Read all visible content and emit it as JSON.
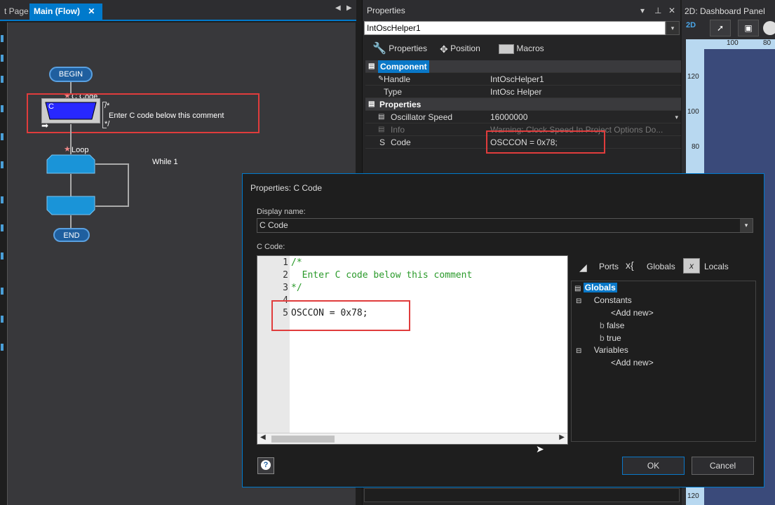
{
  "tabs": {
    "start_page": "t Page",
    "main_flow": "Main (Flow)",
    "close": "✕"
  },
  "flowchart": {
    "begin": "BEGIN",
    "ccode_label": "C Code",
    "ccode_letter": "C",
    "comment_open": "/*",
    "comment_text": "Enter C code below this comment",
    "comment_close": "*/",
    "loop_label": "Loop",
    "while_label": "While 1",
    "end": "END"
  },
  "properties_panel": {
    "title": "Properties",
    "selected_component": "IntOscHelper1",
    "toolbar": {
      "properties": "Properties",
      "position": "Position",
      "macros": "Macros"
    },
    "sections": {
      "component": "Component",
      "properties": "Properties"
    },
    "rows": {
      "handle_name": "Handle",
      "handle_value": "IntOscHelper1",
      "type_name": "Type",
      "type_value": "IntOsc Helper",
      "osc_name": "Oscillator Speed",
      "osc_value": "16000000",
      "info_name": "Info",
      "info_value": "Warning: Clock Speed In Project Options Do...",
      "code_name": "Code",
      "code_value": "OSCCON = 0x78;"
    }
  },
  "dashboard": {
    "title": "2D: Dashboard Panel",
    "mode": "2D",
    "ruler_top": [
      "100",
      "80"
    ],
    "ruler_left": [
      "120",
      "100",
      "80",
      "120"
    ]
  },
  "dialog": {
    "title": "Properties: C Code",
    "display_name_label": "Display name:",
    "display_name_value": "C Code",
    "c_code_label": "C Code:",
    "lines": [
      {
        "n": "1",
        "text": "/*"
      },
      {
        "n": "2",
        "text": "  Enter C code below this comment"
      },
      {
        "n": "3",
        "text": "*/"
      },
      {
        "n": "4",
        "text": ""
      },
      {
        "n": "5",
        "text": "OSCCON = 0x78;"
      }
    ],
    "side_tabs": {
      "ports": "Ports",
      "globals": "Globals",
      "locals": "Locals"
    },
    "tree": {
      "root": "Globals",
      "constants": "Constants",
      "add_new_1": "<Add new>",
      "false": "false",
      "true": "true",
      "variables": "Variables",
      "add_new_2": "<Add new>"
    },
    "ok": "OK",
    "cancel": "Cancel",
    "help": "?"
  }
}
